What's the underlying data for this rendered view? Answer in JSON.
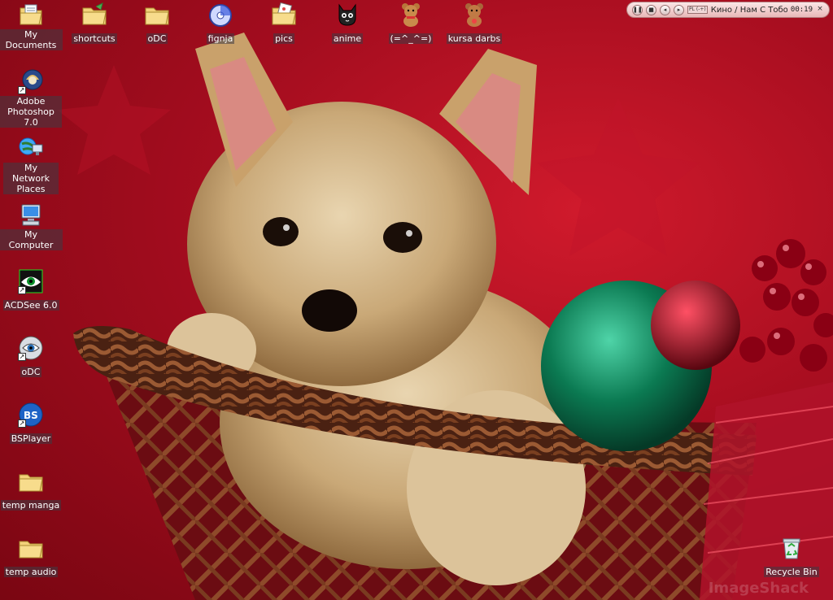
{
  "desktop": {
    "icons_top": [
      {
        "label": "My Documents",
        "icon": "my-documents-icon"
      },
      {
        "label": "shortcuts",
        "icon": "folder-icon"
      },
      {
        "label": "oDC",
        "icon": "folder-icon"
      },
      {
        "label": "fignja",
        "icon": "disc-icon"
      },
      {
        "label": "pics",
        "icon": "picture-folder-icon"
      },
      {
        "label": "anime",
        "icon": "cat-icon"
      },
      {
        "label": "(=^_^=)",
        "icon": "teddy-bear-icon"
      },
      {
        "label": "kursa darbs",
        "icon": "teddy-bear-icon"
      }
    ],
    "icons_left": [
      {
        "label": "Adobe Photoshop 7.0",
        "icon": "photoshop-icon"
      },
      {
        "label": "My Network Places",
        "icon": "network-icon"
      },
      {
        "label": "My Computer",
        "icon": "computer-icon"
      },
      {
        "label": "ACDSee 6.0",
        "icon": "eye-icon"
      },
      {
        "label": "oDC",
        "icon": "eye-icon"
      },
      {
        "label": "BSPlayer",
        "icon": "bsplayer-icon"
      },
      {
        "label": "temp manga",
        "icon": "folder-icon"
      },
      {
        "label": "temp audio",
        "icon": "folder-icon"
      }
    ],
    "recycle_bin": {
      "label": "Recycle Bin",
      "icon": "recycle-bin-icon"
    }
  },
  "player": {
    "mode_label": "PL (-+)",
    "track": "Кино / Нам С Тобой",
    "time": "00:19",
    "close": "×"
  },
  "watermark": "ImageShack",
  "colors": {
    "wallpaper_red": "#b0101f",
    "label_bg": "#3c3c46"
  }
}
